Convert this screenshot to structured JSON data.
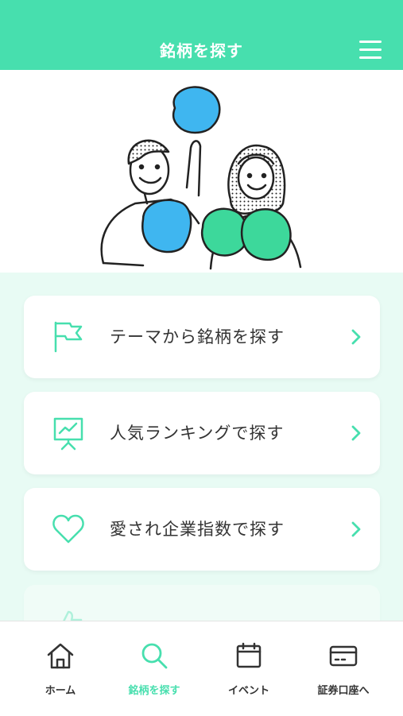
{
  "header": {
    "title": "銘柄を探す",
    "menu_icon": "hamburger-menu-icon"
  },
  "colors": {
    "accent": "#47dfae",
    "accent_light": "#e8fbf4",
    "text": "#333333",
    "pompom_blue": "#3fb6f0"
  },
  "hero": {
    "image": "cheerleaders-illustration"
  },
  "menu": {
    "items": [
      {
        "label": "テーマから銘柄を探す",
        "icon": "flag-icon"
      },
      {
        "label": "人気ランキングで探す",
        "icon": "chart-board-icon"
      },
      {
        "label": "愛され企業指数で探す",
        "icon": "heart-icon"
      },
      {
        "label": "",
        "icon": "thumbs-up-icon"
      }
    ]
  },
  "tabbar": {
    "tabs": [
      {
        "label": "ホーム",
        "icon": "home-icon",
        "active": false
      },
      {
        "label": "銘柄を探す",
        "icon": "search-icon",
        "active": true
      },
      {
        "label": "イベント",
        "icon": "calendar-icon",
        "active": false
      },
      {
        "label": "証券口座へ",
        "icon": "credit-card-icon",
        "active": false
      }
    ]
  }
}
